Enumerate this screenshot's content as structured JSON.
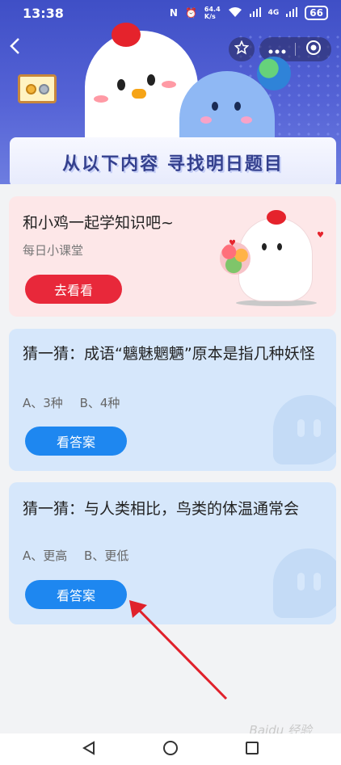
{
  "status_bar": {
    "time": "13:38",
    "network_speed_value": "64.4",
    "network_speed_unit": "K/s",
    "signal_1": "4G",
    "battery": "66"
  },
  "hero": {
    "banner_title": "从以下内容 寻找明日题目"
  },
  "cards": [
    {
      "title": "和小鸡一起学知识吧~",
      "subtitle": "每日小课堂",
      "button": "去看看"
    },
    {
      "title": "猜一猜：成语“魑魅魍魉”原本是指几种妖怪",
      "options": [
        "A、3种",
        "B、4种"
      ],
      "button": "看答案"
    },
    {
      "title": "猜一猜：与人类相比，鸟类的体温通常会",
      "options": [
        "A、更高",
        "B、更低"
      ],
      "button": "看答案"
    }
  ],
  "watermark": "Baidu 经验",
  "icons": {
    "back": "chevron-left-icon",
    "favorite": "star-icon",
    "more": "more-dots-icon",
    "close_applet": "target-icon",
    "nav_back": "triangle-back-icon",
    "nav_home": "circle-home-icon",
    "nav_recent": "square-recent-icon"
  },
  "colors": {
    "hero": "#4a58cc",
    "red_button": "#e8283a",
    "blue_button": "#1e87f0",
    "pink_card": "#fde7e8",
    "blue_card": "#d6e7fb",
    "arrow": "#e0212b"
  }
}
